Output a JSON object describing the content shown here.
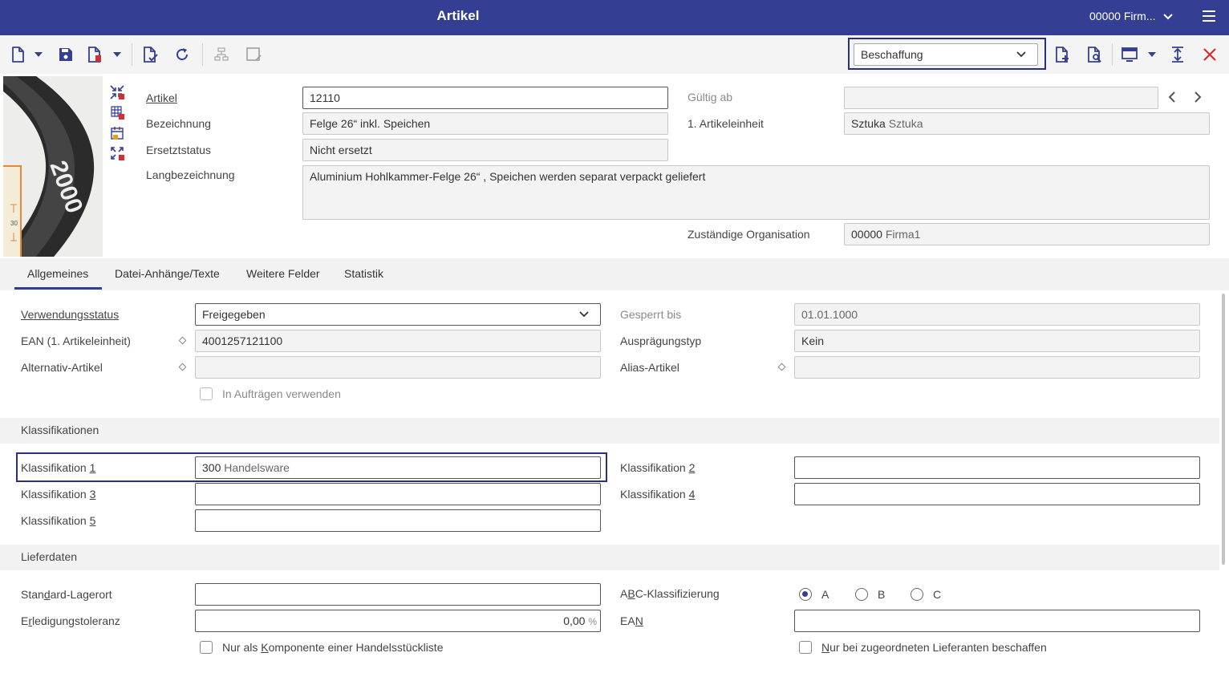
{
  "header": {
    "title": "Artikel",
    "company": "00000 Firm..."
  },
  "toolbar": {
    "view_select": "Beschaffung"
  },
  "artikel": {
    "artikel_label": "Artikel",
    "artikel_value": "12110",
    "bezeichnung_label": "Bezeichnung",
    "bezeichnung_value": "Felge  26“ inkl. Speichen",
    "ersetzt_label": "Ersetztstatus",
    "ersetzt_value": "Nicht ersetzt",
    "lang_label": "Langbezeichnung",
    "lang_value": "Aluminium Hohlkammer-Felge  26“ , Speichen werden separat verpackt geliefert",
    "gueltig_label": "Gültig ab",
    "gueltig_value": "",
    "einheit_label": "1. Artikeleinheit",
    "einheit_code": "Sztuka",
    "einheit_name": "Sztuka",
    "org_label": "Zuständige Organisation",
    "org_code": "00000",
    "org_name": "Firma1"
  },
  "image": {
    "rim_text": "2000",
    "ruler_value": "30"
  },
  "tabs": [
    {
      "label": "Allgemeines",
      "active": true
    },
    {
      "label": "Datei-Anhänge/Texte"
    },
    {
      "label": "Weitere Felder"
    },
    {
      "label": "Statistik"
    }
  ],
  "allgemein": {
    "verwendung_label": "Verwendungsstatus",
    "verwendung_value": "Freigegeben",
    "ean_label": "EAN (1. Artikeleinheit)",
    "ean_value": "4001257121100",
    "alt_label": "Alternativ-Artikel",
    "alt_value": "",
    "auftraege_label": "In Aufträgen verwenden",
    "gesperrt_label": "Gesperrt bis",
    "gesperrt_value": "01.01.1000",
    "auspraegung_label": "Ausprägungstyp",
    "auspraegung_value": "Kein",
    "alias_label": "Alias-Artikel",
    "alias_value": ""
  },
  "klassifikationen": {
    "title": "Klassifikationen",
    "k_label": "Klassifikation ",
    "n1": "1",
    "n2": "2",
    "n3": "3",
    "n4": "4",
    "n5": "5",
    "k1_code": "300",
    "k1_name": "Handelsware"
  },
  "lieferdaten": {
    "title": "Lieferdaten",
    "lagerort_a": "Stan",
    "lagerort_u": "d",
    "lagerort_b": "ard-Lagerort",
    "toleranz_a": "E",
    "toleranz_u": "r",
    "toleranz_b": "ledigungstoleranz",
    "toleranz_value": "0,00",
    "toleranz_unit": "%",
    "komponente_a": "Nur als ",
    "komponente_u": "K",
    "komponente_b": "omponente einer Handelsstückliste",
    "abc_a": "A",
    "abc_u": "B",
    "abc_b": "C-Klassifizierung",
    "abc_options": [
      "A",
      "B",
      "C"
    ],
    "abc_selected": "A",
    "ean_a": "EA",
    "ean_u": "N",
    "lieferanten_u": "N",
    "lieferanten_b": "ur bei zugeordneten Lieferanten beschaffen"
  }
}
